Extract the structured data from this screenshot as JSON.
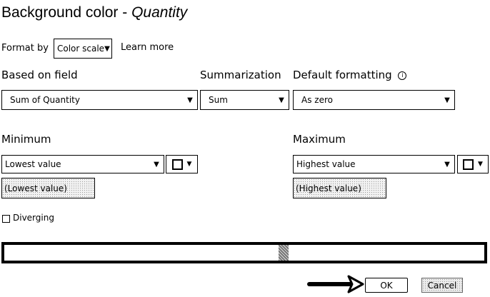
{
  "dialog": {
    "title_prefix": "Background color - ",
    "title_field": "Quantity"
  },
  "format_by": {
    "label": "Format by",
    "value": "Color scale",
    "learn_more": "Learn more"
  },
  "based_on_field": {
    "label": "Based on field",
    "value": "Sum of Quantity"
  },
  "summarization": {
    "label": "Summarization",
    "value": "Sum"
  },
  "default_formatting": {
    "label": "Default formatting",
    "value": "As zero"
  },
  "minimum": {
    "label": "Minimum",
    "value": "Lowest value",
    "input": "(Lowest value)"
  },
  "maximum": {
    "label": "Maximum",
    "value": "Highest value",
    "input": "(Highest value)"
  },
  "diverging": {
    "label": "Diverging",
    "checked": false
  },
  "buttons": {
    "ok": "OK",
    "cancel": "Cancel"
  },
  "colors": {
    "min_color": "#ffffff",
    "max_color": "#ffffff"
  }
}
